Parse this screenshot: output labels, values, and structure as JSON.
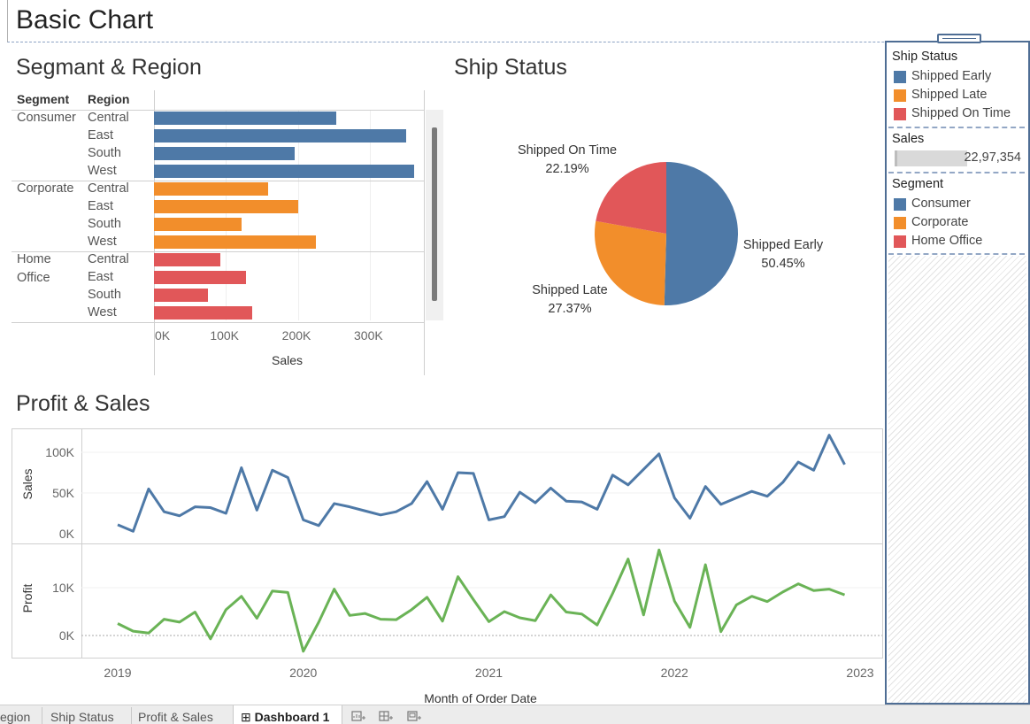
{
  "dashboard": {
    "title": "Basic Chart"
  },
  "colors": {
    "blue": "#4e79a7",
    "orange": "#f28e2b",
    "red": "#e15759",
    "green": "#6ab356"
  },
  "segment_region": {
    "title": "Segmant & Region",
    "header_segment": "Segment",
    "header_region": "Region",
    "segments": [
      {
        "name": "Consumer",
        "name_line2": "",
        "color": "#4e79a7",
        "regions": [
          "Central",
          "East",
          "South",
          "West"
        ]
      },
      {
        "name": "Corporate",
        "name_line2": "",
        "color": "#f28e2b",
        "regions": [
          "Central",
          "East",
          "South",
          "West"
        ]
      },
      {
        "name": "Home",
        "name_line2": "Office",
        "color": "#e15759",
        "regions": [
          "Central",
          "East",
          "South",
          "West"
        ]
      }
    ]
  },
  "ship_status": {
    "title": "Ship Status",
    "slices": [
      {
        "name": "Shipped Early",
        "pct": "50.45%",
        "value": 50.45,
        "color": "#4e79a7"
      },
      {
        "name": "Shipped Late",
        "pct": "27.37%",
        "value": 27.37,
        "color": "#f28e2b"
      },
      {
        "name": "Shipped On Time",
        "pct": "22.19%",
        "value": 22.19,
        "color": "#e15759"
      }
    ]
  },
  "profit_sales": {
    "title": "Profit & Sales",
    "sales_label": "Sales",
    "profit_label": "Profit",
    "sales_ticks": [
      "100K",
      "50K",
      "0K"
    ],
    "profit_ticks": [
      "10K",
      "0K"
    ],
    "x_ticks": [
      "2019",
      "2020",
      "2021",
      "2022",
      "2023"
    ],
    "x_title": "Month of Order Date"
  },
  "legend": {
    "ship_status_title": "Ship Status",
    "ship_status_items": [
      {
        "label": "Shipped Early",
        "color": "#4e79a7"
      },
      {
        "label": "Shipped Late",
        "color": "#f28e2b"
      },
      {
        "label": "Shipped On Time",
        "color": "#e15759"
      }
    ],
    "sales_title": "Sales",
    "sales_value": "22,97,354",
    "segment_title": "Segment",
    "segment_items": [
      {
        "label": "Consumer",
        "color": "#4e79a7"
      },
      {
        "label": "Corporate",
        "color": "#f28e2b"
      },
      {
        "label": "Home Office",
        "color": "#e15759"
      }
    ]
  },
  "tabs": {
    "items": [
      "egion",
      "Ship Status",
      "Profit & Sales",
      "Dashboard 1"
    ],
    "selected": "Dashboard 1",
    "new_sheet_icon": "new-worksheet-icon",
    "new_dashboard_icon": "new-dashboard-icon",
    "new_story_icon": "new-story-icon"
  },
  "chart_data": [
    {
      "type": "bar",
      "title": "Segmant & Region",
      "xlabel": "Sales",
      "x_ticks": [
        "0K",
        "100K",
        "200K",
        "300K"
      ],
      "xlim": [
        0,
        375000
      ],
      "categories": [
        "Consumer / Central",
        "Consumer / East",
        "Consumer / South",
        "Consumer / West",
        "Corporate / Central",
        "Corporate / East",
        "Corporate / South",
        "Corporate / West",
        "Home Office / Central",
        "Home Office / East",
        "Home Office / South",
        "Home Office / West"
      ],
      "values": [
        253000,
        351000,
        196000,
        362000,
        158000,
        201000,
        122000,
        225000,
        92000,
        128000,
        75000,
        137000
      ],
      "grid": true
    },
    {
      "type": "pie",
      "title": "Ship Status",
      "categories": [
        "Shipped Early",
        "Shipped Late",
        "Shipped On Time"
      ],
      "values": [
        50.45,
        27.37,
        22.19
      ]
    },
    {
      "type": "line",
      "title": "Profit & Sales",
      "xlabel": "Month of Order Date",
      "xlim": [
        "2018-12",
        "2023-01"
      ],
      "x": [
        "2019-01",
        "2019-02",
        "2019-03",
        "2019-04",
        "2019-05",
        "2019-06",
        "2019-07",
        "2019-08",
        "2019-09",
        "2019-10",
        "2019-11",
        "2019-12",
        "2020-01",
        "2020-02",
        "2020-03",
        "2020-04",
        "2020-05",
        "2020-06",
        "2020-07",
        "2020-08",
        "2020-09",
        "2020-10",
        "2020-11",
        "2020-12",
        "2021-01",
        "2021-02",
        "2021-03",
        "2021-04",
        "2021-05",
        "2021-06",
        "2021-07",
        "2021-08",
        "2021-09",
        "2021-10",
        "2021-11",
        "2021-12",
        "2022-01",
        "2022-02",
        "2022-03",
        "2022-04",
        "2022-05",
        "2022-06",
        "2022-07",
        "2022-08",
        "2022-09",
        "2022-10",
        "2022-11",
        "2022-12"
      ],
      "series": [
        {
          "name": "Sales",
          "ylim": [
            0,
            125000
          ],
          "values": [
            11000,
            3000,
            55000,
            27000,
            22000,
            33000,
            32000,
            25000,
            81000,
            29000,
            78000,
            69000,
            17000,
            10000,
            37000,
            33000,
            28000,
            23000,
            27000,
            37000,
            64000,
            30000,
            75000,
            74000,
            17000,
            21000,
            51000,
            38000,
            56000,
            40000,
            39000,
            30000,
            72000,
            60000,
            79000,
            98000,
            44000,
            19000,
            58000,
            36000,
            44000,
            52000,
            46000,
            63000,
            88000,
            78000,
            121000,
            85000
          ]
        },
        {
          "name": "Profit",
          "ylim": [
            -2500,
            15000
          ],
          "values": [
            2500,
            900,
            500,
            3400,
            2800,
            4900,
            -700,
            5400,
            8200,
            3600,
            9300,
            9000,
            -3300,
            2800,
            9700,
            4200,
            4600,
            3400,
            3300,
            5400,
            8000,
            3000,
            12300,
            7500,
            2900,
            5000,
            3700,
            3100,
            8500,
            4900,
            4500,
            2200,
            8800,
            16000,
            4300,
            17900,
            7200,
            1700,
            14800,
            800,
            6400,
            8200,
            7100,
            9100,
            10800,
            9400,
            9700,
            8500
          ]
        }
      ]
    }
  ]
}
